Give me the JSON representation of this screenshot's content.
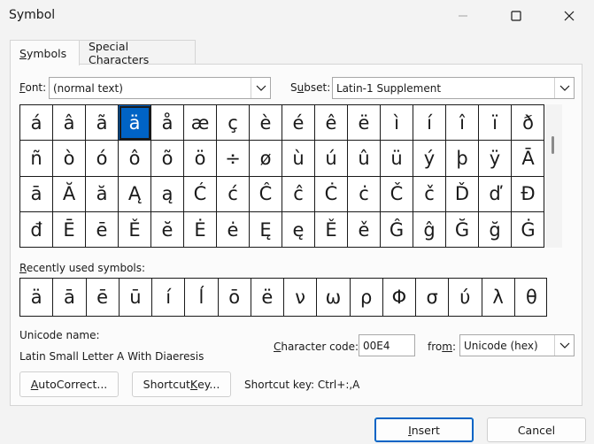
{
  "window": {
    "title": "Symbol"
  },
  "tabs": [
    {
      "label_u": "S",
      "label_rest": "ymbols"
    },
    {
      "label_u": "S",
      "label_prefix": "",
      "label_rest": "pecial Characters",
      "full": "Special Characters"
    }
  ],
  "font": {
    "label_u": "F",
    "label_rest": "ont:",
    "value": "(normal text)"
  },
  "subset": {
    "label_pre": "S",
    "label_u": "u",
    "label_rest": "bset:",
    "value": "Latin-1 Supplement"
  },
  "symbols": [
    [
      "á",
      "â",
      "ã",
      "ä",
      "å",
      "æ",
      "ç",
      "è",
      "é",
      "ê",
      "ë",
      "ì",
      "í",
      "î",
      "ï",
      "ð"
    ],
    [
      "ñ",
      "ò",
      "ó",
      "ô",
      "õ",
      "ö",
      "÷",
      "ø",
      "ù",
      "ú",
      "û",
      "ü",
      "ý",
      "þ",
      "ÿ",
      "Ā"
    ],
    [
      "ā",
      "Ă",
      "ă",
      "Ą",
      "ą",
      "Ć",
      "ć",
      "Ĉ",
      "ĉ",
      "Ċ",
      "ċ",
      "Č",
      "č",
      "Ď",
      "ď",
      "Đ"
    ],
    [
      "đ",
      "Ē",
      "ē",
      "Ě",
      "ĕ",
      "Ė",
      "ė",
      "Ę",
      "ę",
      "Ě",
      "ě",
      "Ĝ",
      "ĝ",
      "Ğ",
      "ğ",
      "Ġ"
    ]
  ],
  "selected": {
    "row": 0,
    "col": 3
  },
  "recent": {
    "label_u": "R",
    "label_rest": "ecently used symbols:",
    "items": [
      "ä",
      "ā",
      "ē",
      "ū",
      "í",
      "ĺ",
      "ō",
      "ë",
      "ν",
      "ω",
      "ρ",
      "Φ",
      "σ",
      "ύ",
      "λ",
      "θ"
    ]
  },
  "unicode_name": {
    "label": "Unicode name:",
    "value": "Latin Small Letter A With Diaeresis"
  },
  "char_code": {
    "label_u": "C",
    "label_rest": "haracter code:",
    "value": "00E4"
  },
  "from": {
    "label_pre": "fro",
    "label_u": "m",
    "label_rest": ":",
    "value": "Unicode (hex)"
  },
  "buttons": {
    "autocorrect_u": "A",
    "autocorrect_rest": "utoCorrect...",
    "shortcut_pre": "Shortcut ",
    "shortcut_u": "K",
    "shortcut_rest": "ey...",
    "insert_u": "I",
    "insert_rest": "nsert",
    "cancel": "Cancel"
  },
  "shortcut_key": {
    "label": "Shortcut key: Ctrl+:,A"
  }
}
